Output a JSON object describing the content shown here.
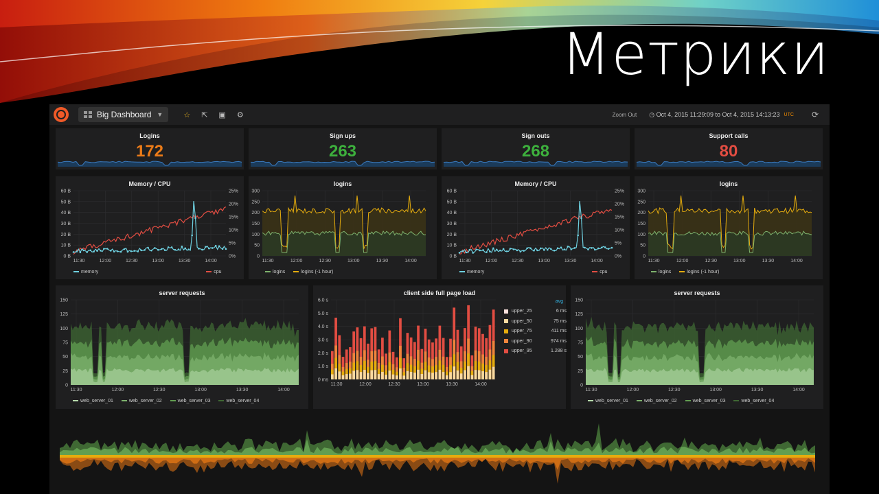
{
  "slide": {
    "title": "Метрики"
  },
  "topbar": {
    "dashboard_name": "Big Dashboard",
    "zoom_out": "Zoom Out",
    "time_range": "Oct 4, 2015 11:29:09 to Oct 4, 2015 14:13:23",
    "timezone": "UTC"
  },
  "stats": [
    {
      "title": "Logins",
      "value": "172",
      "color": "#eb7b18"
    },
    {
      "title": "Sign ups",
      "value": "263",
      "color": "#3db03d"
    },
    {
      "title": "Sign outs",
      "value": "268",
      "color": "#3db03d"
    },
    {
      "title": "Support calls",
      "value": "80",
      "color": "#e24d42"
    }
  ],
  "memcpu": {
    "title": "Memory / CPU",
    "y_left": [
      "60 B",
      "50 B",
      "40 B",
      "30 B",
      "20 B",
      "10 B",
      "0 B"
    ],
    "y_right": [
      "25%",
      "20%",
      "15%",
      "10%",
      "5%",
      "0%"
    ],
    "x": [
      "11:30",
      "12:00",
      "12:30",
      "13:00",
      "13:30",
      "14:00"
    ],
    "legend": [
      {
        "name": "memory",
        "color": "#6ed0e0"
      },
      {
        "name": "cpu",
        "color": "#e24d42"
      }
    ]
  },
  "logins": {
    "title": "logins",
    "y": [
      "300",
      "250",
      "200",
      "150",
      "100",
      "50",
      "0"
    ],
    "x": [
      "11:30",
      "12:00",
      "12:30",
      "13:00",
      "13:30",
      "14:00"
    ],
    "legend": [
      {
        "name": "logins",
        "color": "#7eb26d"
      },
      {
        "name": "logins (-1 hour)",
        "color": "#e5ac0e"
      }
    ]
  },
  "server": {
    "title": "server requests",
    "y": [
      "150",
      "125",
      "100",
      "75",
      "50",
      "25",
      "0"
    ],
    "x": [
      "11:30",
      "12:00",
      "12:30",
      "13:00",
      "13:30",
      "14:00"
    ],
    "legend": [
      {
        "name": "web_server_01",
        "color": "#b7dbab"
      },
      {
        "name": "web_server_02",
        "color": "#7eb26d"
      },
      {
        "name": "web_server_03",
        "color": "#629e51"
      },
      {
        "name": "web_server_04",
        "color": "#3f6833"
      }
    ]
  },
  "pageload": {
    "title": "client side full page load",
    "y": [
      "6.0 s",
      "5.0 s",
      "4.0 s",
      "3.0 s",
      "2.0 s",
      "1.0 s",
      "0 ms"
    ],
    "x": [
      "11:30",
      "12:00",
      "12:30",
      "13:00",
      "13:30",
      "14:00"
    ],
    "legend_header": "avg",
    "legend": [
      {
        "name": "upper_25",
        "value": "6 ms",
        "color": "#fce2de"
      },
      {
        "name": "upper_50",
        "value": "75 ms",
        "color": "#f9d9a0"
      },
      {
        "name": "upper_75",
        "value": "411 ms",
        "color": "#e5ac0e"
      },
      {
        "name": "upper_90",
        "value": "974 ms",
        "color": "#ef843c"
      },
      {
        "name": "upper_95",
        "value": "1.288 s",
        "color": "#e24d42"
      }
    ]
  }
}
